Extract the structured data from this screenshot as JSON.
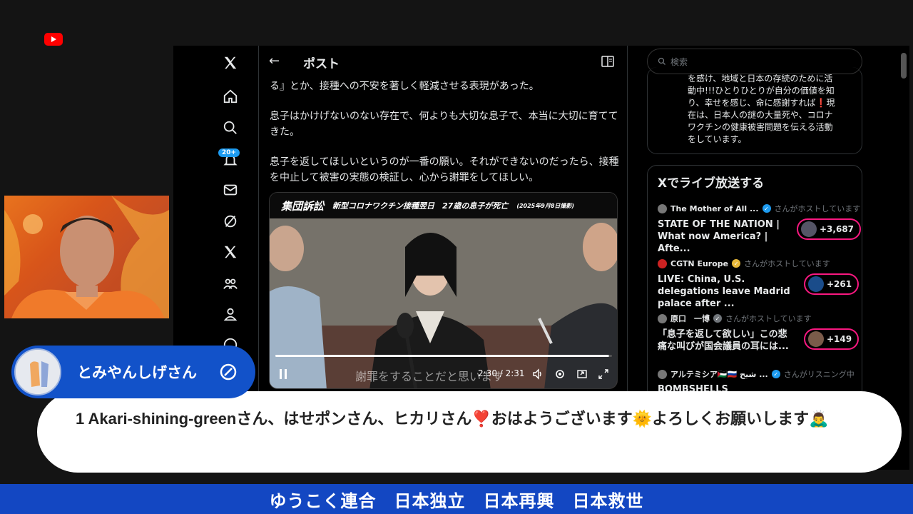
{
  "x_app": {
    "nav": {
      "logo_icon": "x-logo-icon",
      "items": [
        "home-icon",
        "search-icon",
        "bell-icon",
        "mail-icon",
        "grok-icon",
        "x-premium-icon",
        "communities-icon",
        "profile-icon",
        "more-icon"
      ],
      "notification_badge": "20+"
    },
    "header": {
      "title": "ポスト",
      "back_icon": "arrow-left-icon",
      "reader_icon": "reader-icon"
    },
    "post": {
      "paragraphs": [
        "る』とか、接種への不安を著しく軽減させる表現があった。",
        "息子はかけげないのない存在で、何よりも大切な息子で、本当に大切に育ててきた。",
        "息子を返してほしいというのが一番の願い。それができないのだったら、接種を中止して被害の実態の検証し、心から謝罪をしてほしい。"
      ]
    },
    "video": {
      "caption_main": "集団訴訟",
      "caption_sub": "新型コロナワクチン接種翌日　27歳の息子が死亡",
      "caption_date": "(2025年9月8日撮影)",
      "subtitle": "謝罪をすることだと思います",
      "time": "2:30 / 2:31",
      "progress": 0.99
    },
    "search": {
      "placeholder": "検索"
    },
    "bio": {
      "lines": [
        "を感け、地域と日本の存続のために活",
        "動中!!!ひとりひとりが自分の価値を知",
        "り、幸せを感じ、命に感謝すれば❗現",
        "在は、日本人の謎の大量死や、コロナ",
        "ワクチンの健康被害問題を伝える活動",
        "をしています。"
      ]
    },
    "live": {
      "title": "Xでライブ放送する",
      "items": [
        {
          "host": "The Mother of All ...",
          "status": "さんがホストしています",
          "title": "STATE OF THE NATION | What now America? | Afte...",
          "count": "+3,687"
        },
        {
          "host": "CGTN Europe",
          "status": "さんがホストしています",
          "title": "LIVE: China, U.S. delegations leave Madrid palace after ...",
          "count": "+261"
        },
        {
          "host": "原口　一博",
          "status": "さんがホストしています",
          "title": "「息子を返して欲しい」この悲痛な叫びが国会議員の耳には...",
          "count": "+149"
        },
        {
          "host": "アルテミシア🇵🇸🇷🇺 شيح ...",
          "status": "さんがリスニング中",
          "title": "BOMBSHELLS",
          "count": ""
        }
      ]
    }
  },
  "chat": {
    "author": "とみやんしげさん",
    "avatar_text": "とみやん しげ",
    "message": "1 Akari-shining-greenさん、はせポンさん、ヒカリさん❣️おはようございます🌞よろしくお願いします🙇‍♂️"
  },
  "ticker": {
    "text": "ゆうこく連合　日本独立　日本再興　日本救世"
  },
  "colors": {
    "x_background": "#000000",
    "accent_blue": "#1d9bf0",
    "live_pink": "#f91880",
    "chat_blue": "#1252c9",
    "ticker_blue": "#1347c2"
  }
}
